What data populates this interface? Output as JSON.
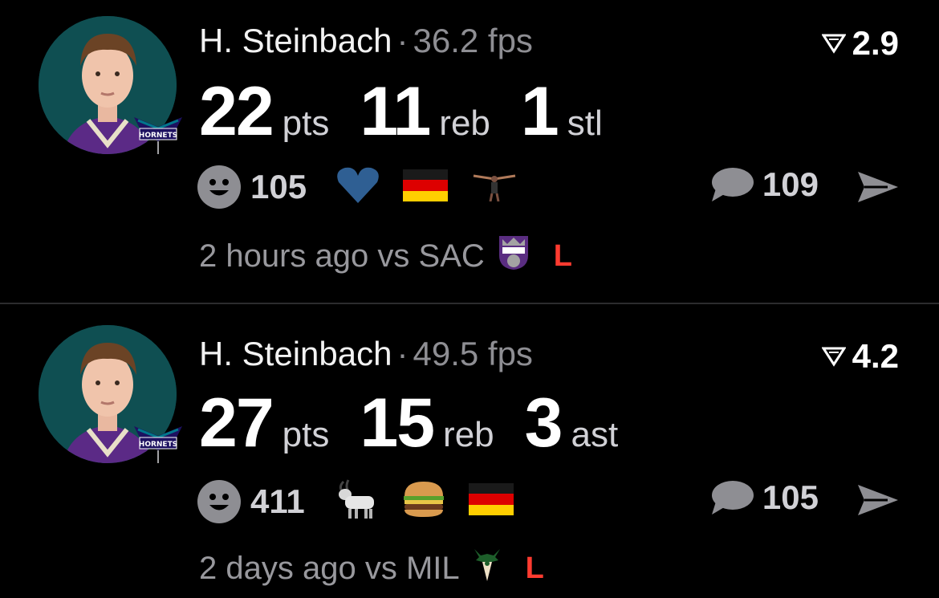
{
  "feed": [
    {
      "player": "H. Steinbach",
      "separator": "·",
      "fps": "36.2 fps",
      "score": "2.9",
      "stats": [
        {
          "value": "22",
          "unit": "pts"
        },
        {
          "value": "11",
          "unit": "reb"
        },
        {
          "value": "1",
          "unit": "stl"
        }
      ],
      "reaction_count": "105",
      "reaction_emojis": [
        "blue-heart-icon",
        "germany-flag-icon",
        "dunk-figure-icon"
      ],
      "comment_count": "109",
      "time": "2 hours ago",
      "versus": "vs SAC",
      "opponent_logo": "kings-logo",
      "result": "L",
      "result_color": "#ff3b30",
      "team_logo": "hornets-logo"
    },
    {
      "player": "H. Steinbach",
      "separator": "·",
      "fps": "49.5 fps",
      "score": "4.2",
      "stats": [
        {
          "value": "27",
          "unit": "pts"
        },
        {
          "value": "15",
          "unit": "reb"
        },
        {
          "value": "3",
          "unit": "ast"
        }
      ],
      "reaction_count": "411",
      "reaction_emojis": [
        "goat-icon",
        "burger-icon",
        "germany-flag-icon"
      ],
      "comment_count": "105",
      "time": "2 days ago",
      "versus": "vs MIL",
      "opponent_logo": "bucks-logo",
      "result": "L",
      "result_color": "#ff3b30",
      "team_logo": "hornets-logo"
    }
  ],
  "colors": {
    "background": "#000000",
    "muted_text": "#8e8e93",
    "loss_red": "#ff3b30",
    "avatar_bg": "#0f4f52"
  }
}
